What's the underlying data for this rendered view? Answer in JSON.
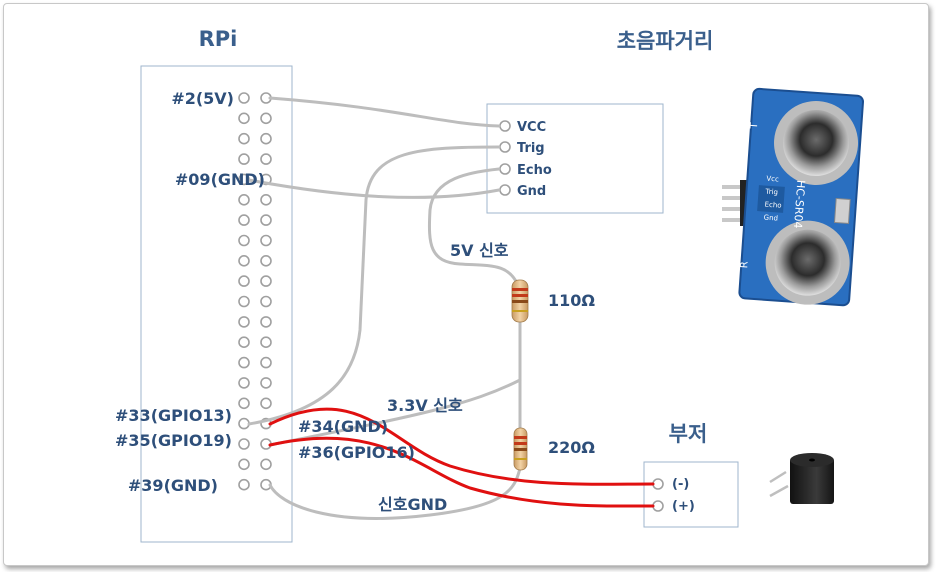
{
  "titles": {
    "rpi": "RPi",
    "ultrasonic": "초음파거리",
    "buzzer": "부저"
  },
  "rpi_pins": {
    "p2": "#2(5V)",
    "p9": "#09(GND)",
    "p33": "#33(GPIO13)",
    "p35": "#35(GPIO19)",
    "p39": "#39(GND)",
    "p34": "#34(GND)",
    "p36": "#36(GPIO16)"
  },
  "sensor_pins": {
    "vcc": "VCC",
    "trig": "Trig",
    "echo": "Echo",
    "gnd": "Gnd"
  },
  "signals": {
    "five_volt": "5V 신호",
    "three_volt": "3.3V 신호",
    "signal_gnd": "신호GND"
  },
  "resistors": {
    "r1": "110Ω",
    "r2": "220Ω"
  },
  "buzzer_pins": {
    "neg": "(-)",
    "pos": "(+)"
  },
  "module_silkscreen": {
    "model": "HC-SR04",
    "pins": [
      "Vcc",
      "Trig",
      "Echo",
      "Gnd"
    ],
    "t": "T",
    "r": "R"
  },
  "colors": {
    "title": "#3a5f8c",
    "label": "#2e4f7a",
    "gray_wire": "#bdbdbd",
    "red_wire": "#e01010",
    "sensor_board": "#2a6fc0"
  }
}
